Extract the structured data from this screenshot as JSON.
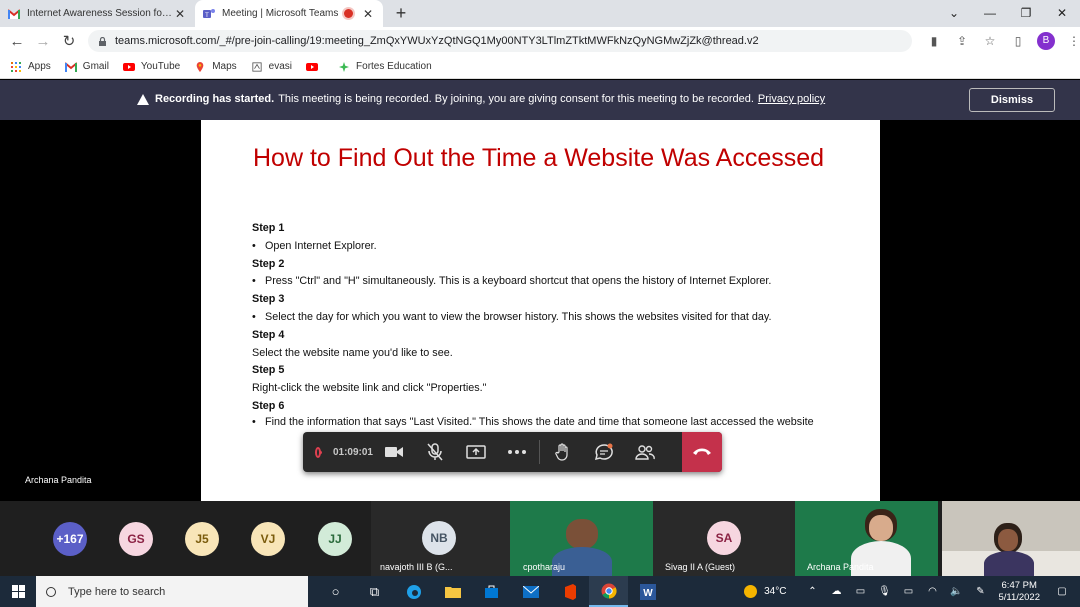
{
  "browser": {
    "tabs": [
      {
        "title": "Internet Awareness Session for P...",
        "active": false
      },
      {
        "title": "Meeting | Microsoft Teams",
        "active": true,
        "recording": true
      }
    ],
    "url": "teams.microsoft.com/_#/pre-join-calling/19:meeting_ZmQxYWUxYzQtNGQ1My00NTY3LTlmZTktMWFkNzQyNGMwZjZk@thread.v2",
    "profile_initial": "B",
    "bookmarks": [
      "Apps",
      "Gmail",
      "YouTube",
      "Maps",
      "evasi",
      "",
      "Fortes Education"
    ]
  },
  "banner": {
    "bold": "Recording has started.",
    "text": "This meeting is being recorded. By joining, you are giving consent for this meeting to be recorded.",
    "link": "Privacy policy",
    "dismiss": "Dismiss"
  },
  "slide": {
    "title": "How to Find Out the Time a Website Was Accessed",
    "lines": [
      {
        "type": "step",
        "text": "Step 1"
      },
      {
        "type": "bullet",
        "text": "Open Internet Explorer."
      },
      {
        "type": "step",
        "text": "Step 2"
      },
      {
        "type": "bullet",
        "text": "Press \"Ctrl\" and \"H\" simultaneously. This is a keyboard shortcut that opens the history of Internet Explorer."
      },
      {
        "type": "step",
        "text": "Step 3"
      },
      {
        "type": "bullet",
        "text": "Select the day for which you want to view the browser history. This shows the websites visited for that day."
      },
      {
        "type": "step",
        "text": "Step 4"
      },
      {
        "type": "plain",
        "text": "Select the website name you'd like to see."
      },
      {
        "type": "step",
        "text": "Step 5"
      },
      {
        "type": "plain",
        "text": "Right-click the website link and click \"Properties.\""
      },
      {
        "type": "step",
        "text": "Step 6"
      },
      {
        "type": "bullet2",
        "text": "Find the information that says \"Last Visited.\" This shows the date and time that someone last accessed the website"
      }
    ]
  },
  "presenter_name": "Archana Pandita",
  "callbar": {
    "elapsed": "01:09:01"
  },
  "participants": {
    "overflow": "+167",
    "avatars": [
      "GS",
      "J5",
      "VJ",
      "JJ"
    ],
    "tiles": [
      {
        "initials": "NB",
        "name": "navajoth III B (G..."
      },
      {
        "initials": "",
        "name": "cpotharaju"
      },
      {
        "initials": "SA",
        "name": "Sivag II A (Guest)"
      },
      {
        "initials": "",
        "name": "Archana Pandita"
      },
      {
        "initials": "",
        "name": ""
      }
    ]
  },
  "taskbar": {
    "search_placeholder": "Type here to search",
    "temperature": "34°C",
    "time": "6:47 PM",
    "date": "5/11/2022"
  },
  "colors": {
    "banner": "#33344a",
    "slide_title": "#c00000",
    "hangup": "#c4314b",
    "avatar_purple": "#5b5fc7"
  }
}
